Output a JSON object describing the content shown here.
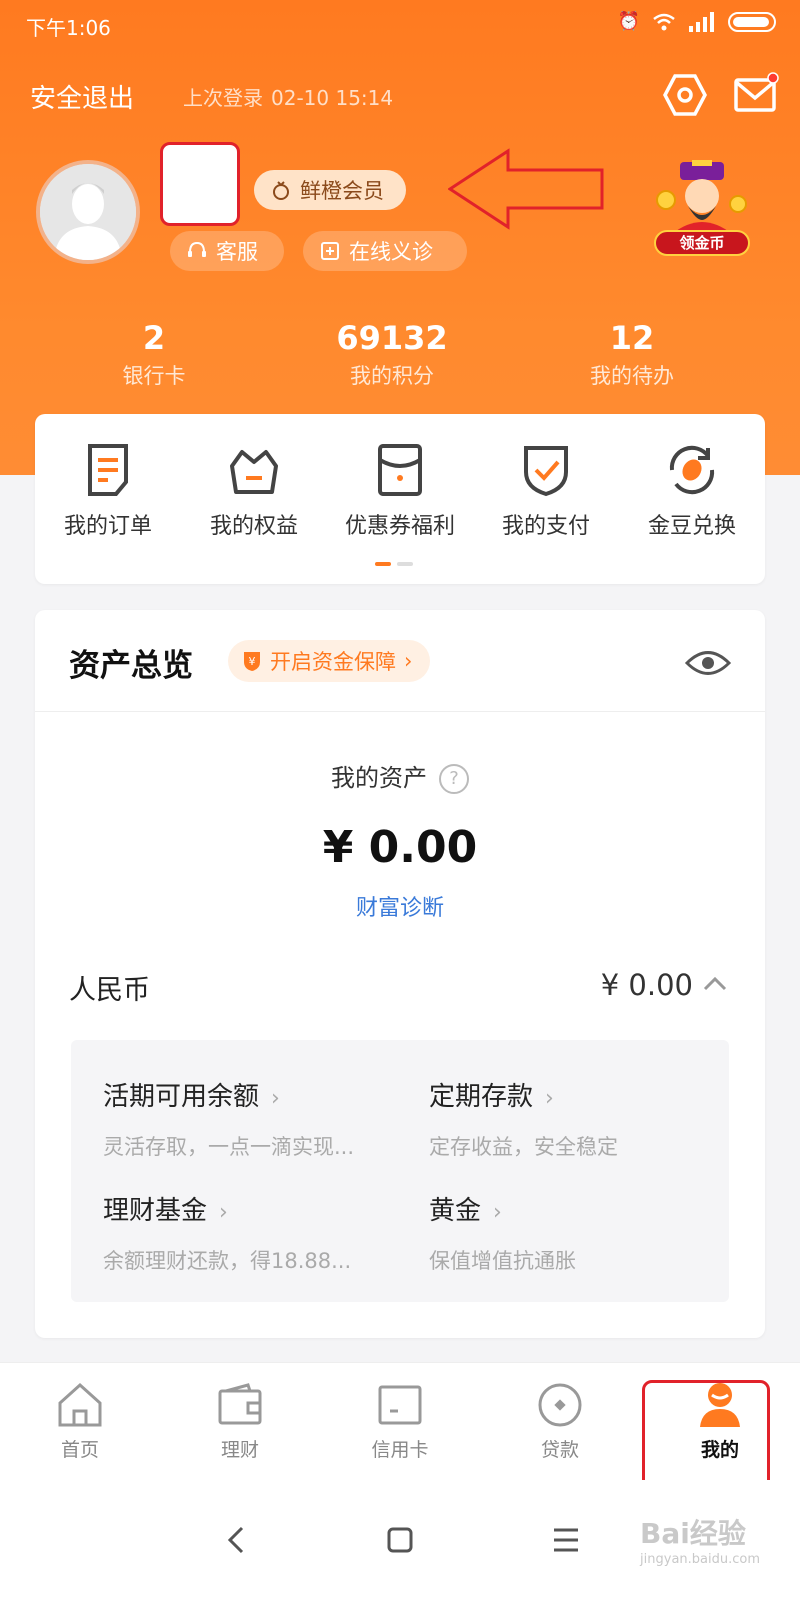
{
  "status_bar": {
    "time": "下午1:06"
  },
  "topbar": {
    "logout": "安全退出",
    "last_login_label": "上次登录",
    "last_login_time": "02-10 15:14"
  },
  "profile": {
    "member_badge": "鲜橙会员",
    "customer_service": "客服",
    "online_clinic": "在线义诊",
    "coin_badge": "领金币"
  },
  "stats": [
    {
      "value": "2",
      "label": "银行卡"
    },
    {
      "value": "69132",
      "label": "我的积分"
    },
    {
      "value": "12",
      "label": "我的待办"
    }
  ],
  "quick_actions": [
    {
      "label": "我的订单",
      "icon": "order-icon"
    },
    {
      "label": "我的权益",
      "icon": "basket-icon"
    },
    {
      "label": "优惠券福利",
      "icon": "coupon-icon"
    },
    {
      "label": "我的支付",
      "icon": "shield-check-icon"
    },
    {
      "label": "金豆兑换",
      "icon": "bean-exchange-icon"
    }
  ],
  "assets": {
    "title": "资产总览",
    "protect_label": "开启资金保障",
    "my_assets_label": "我的资产",
    "help_glyph": "?",
    "total": "¥ 0.00",
    "diagnose": "财富诊断",
    "currency_label": "人民币",
    "currency_value": "¥ 0.00",
    "items": [
      {
        "title": "活期可用余额",
        "subtitle": "灵活存取，一点一滴实现..."
      },
      {
        "title": "定期存款",
        "subtitle": "定存收益，安全稳定"
      },
      {
        "title": "理财基金",
        "subtitle": "余额理财还款，得18.88..."
      },
      {
        "title": "黄金",
        "subtitle": "保值增值抗通胀"
      }
    ]
  },
  "tabs": [
    {
      "label": "首页",
      "icon": "home-icon"
    },
    {
      "label": "理财",
      "icon": "wallet-icon"
    },
    {
      "label": "信用卡",
      "icon": "credit-card-icon"
    },
    {
      "label": "贷款",
      "icon": "loan-icon"
    },
    {
      "label": "我的",
      "icon": "user-icon"
    }
  ],
  "watermark": {
    "brand": "Bai经验",
    "url": "jingyan.baidu.com"
  },
  "colors": {
    "brand_orange": "#ff7a20",
    "highlight_red": "#e1222a",
    "link_blue": "#3a7ad9"
  }
}
